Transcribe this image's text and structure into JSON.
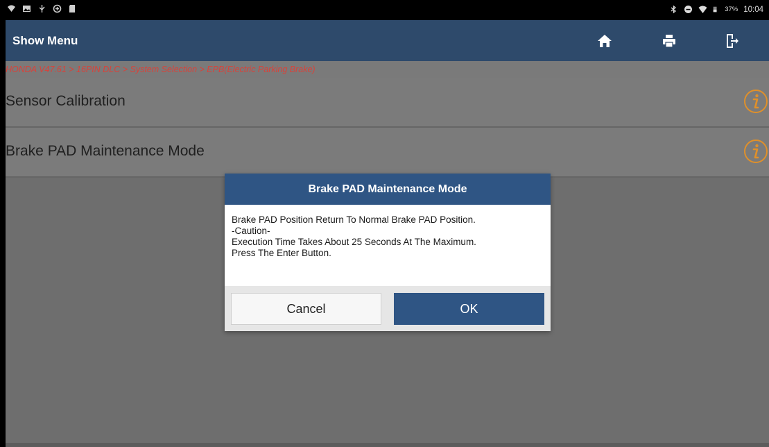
{
  "status_bar": {
    "battery": "37%",
    "time": "10:04"
  },
  "header": {
    "title": "Show Menu",
    "buttons": [
      "home-icon",
      "print-icon",
      "exit-icon"
    ]
  },
  "breadcrumb": "HONDA V47.61 > 16PIN DLC > System Selection > EPB(Electric Parking Brake)",
  "menu": {
    "items": [
      {
        "label": "Sensor Calibration",
        "icon": "info-icon"
      },
      {
        "label": "Brake PAD Maintenance Mode",
        "icon": "info-icon"
      }
    ]
  },
  "dialog": {
    "title": "Brake PAD Maintenance Mode",
    "lines": [
      "Brake PAD Position Return To Normal Brake PAD Position.",
      "-Caution-",
      "Execution Time Takes About 25 Seconds At The Maximum.",
      "Press The Enter Button."
    ],
    "cancel_label": "Cancel",
    "ok_label": "OK"
  },
  "colors": {
    "header": "#2e4a6b",
    "dialog_header": "#2f5584",
    "breadcrumb_text": "#d9423a",
    "info_icon": "#e0902a"
  }
}
